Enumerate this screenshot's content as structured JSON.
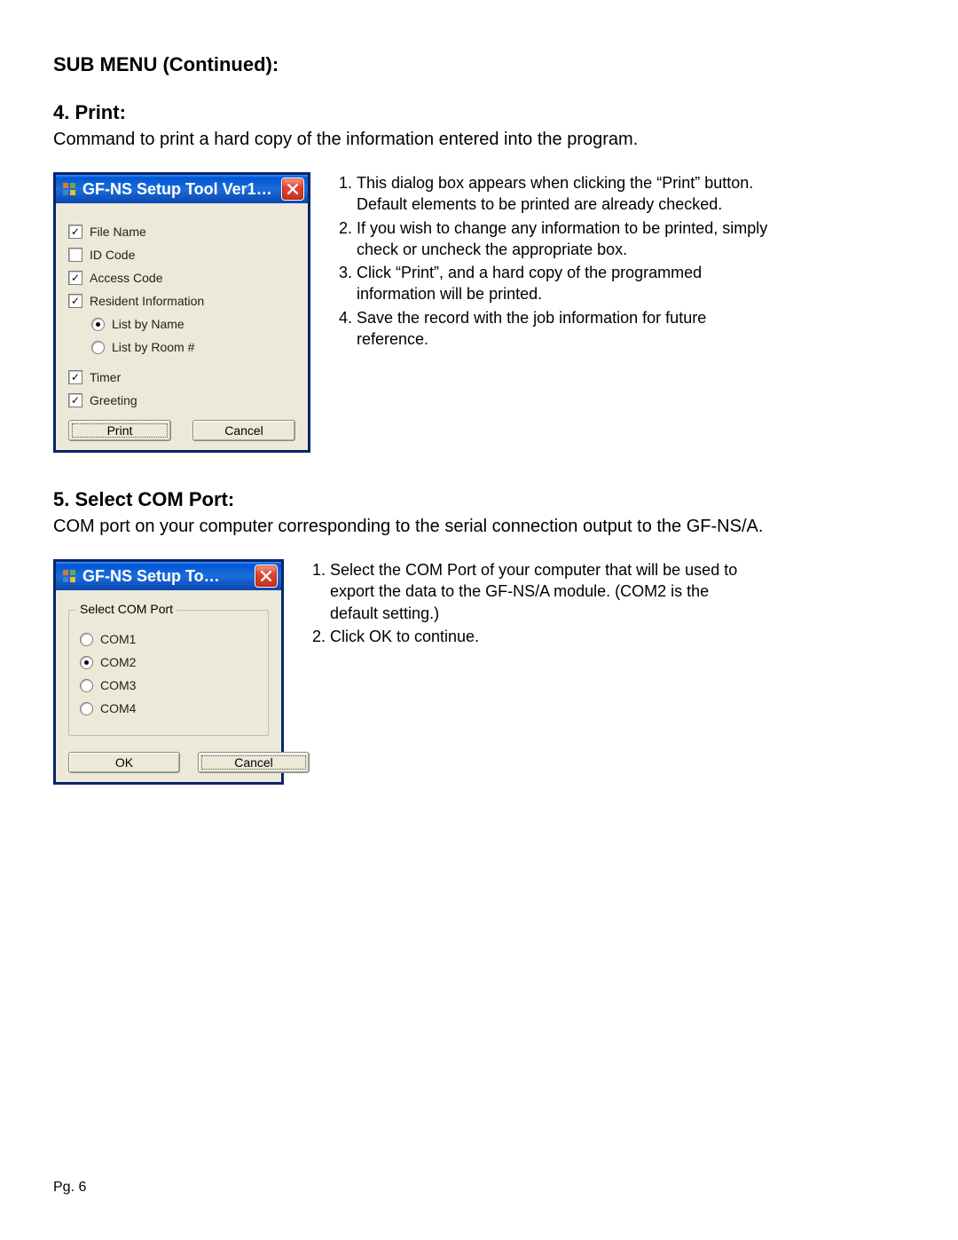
{
  "headings": {
    "main": "SUB MENU (Continued):",
    "print": "4. Print:",
    "comport": "5. Select COM Port:"
  },
  "paragraphs": {
    "print_intro": "Command to print a hard copy of the information entered into the program.",
    "comport_intro": "COM port on your computer corresponding to the serial connection output to the GF-NS/A."
  },
  "dialog_print": {
    "title": "GF-NS Setup Tool Ver1…",
    "options": {
      "file_name": {
        "label": "File Name",
        "checked": true
      },
      "id_code": {
        "label": "ID Code",
        "checked": false
      },
      "access": {
        "label": "Access Code",
        "checked": true
      },
      "resident": {
        "label": "Resident Information",
        "checked": true
      },
      "timer": {
        "label": "Timer",
        "checked": true
      },
      "greeting": {
        "label": "Greeting",
        "checked": true
      }
    },
    "list_mode": {
      "by_name": "List by Name",
      "by_room": "List by Room #",
      "selected": "by_name"
    },
    "buttons": {
      "print": "Print",
      "cancel": "Cancel"
    }
  },
  "dialog_com": {
    "title": "GF-NS Setup To…",
    "group_label": "Select COM Port",
    "ports": {
      "com1": "COM1",
      "com2": "COM2",
      "com3": "COM3",
      "com4": "COM4",
      "selected": "com2"
    },
    "buttons": {
      "ok": "OK",
      "cancel": "Cancel"
    }
  },
  "instructions_print": [
    "This dialog box appears when clicking the “Print” button. Default elements to be printed are already checked.",
    "If you wish to change any information to be printed, simply check or uncheck the appropriate box.",
    "Click “Print”, and a hard copy of the programmed information will be printed.",
    "Save the record with the job information for future reference."
  ],
  "instructions_com": [
    "Select the COM Port of your computer that will be used to export the data to the GF-NS/A module. (COM2 is the default setting.)",
    "Click OK to continue."
  ],
  "footer": {
    "page": "Pg. 6"
  }
}
